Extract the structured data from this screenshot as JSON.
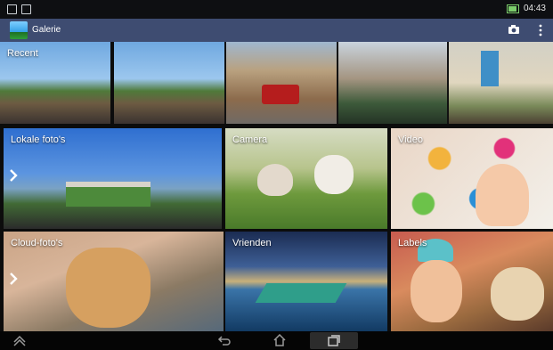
{
  "status_bar": {
    "time": "04:43",
    "left_icons": [
      "screenshot-icon",
      "notification-icon"
    ],
    "battery_color": "#7ccd6b"
  },
  "action_bar": {
    "title": "Galerie",
    "background": "#3e4c71",
    "icons": [
      "gallery-app-icon",
      "camera-icon",
      "overflow-menu-icon"
    ]
  },
  "albums": [
    {
      "id": "recent",
      "label": "Recent"
    },
    {
      "id": "lokale",
      "label": "Lokale foto's"
    },
    {
      "id": "camera",
      "label": "Camera"
    },
    {
      "id": "video",
      "label": "Video"
    },
    {
      "id": "cloud",
      "label": "Cloud-foto's"
    },
    {
      "id": "vrienden",
      "label": "Vrienden"
    },
    {
      "id": "labels",
      "label": "Labels"
    }
  ],
  "nav_bar": {
    "buttons": [
      "hide-nav-icon",
      "back-icon",
      "home-icon",
      "recent-apps-icon"
    ]
  }
}
